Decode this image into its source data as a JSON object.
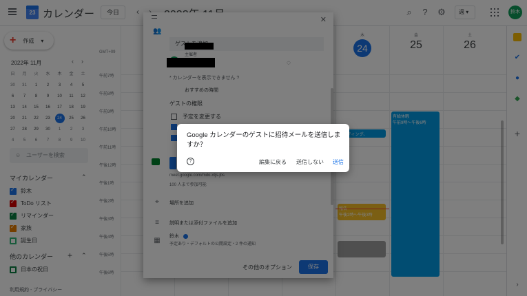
{
  "header": {
    "title": "カレンダー",
    "today_label": "今日",
    "month_title": "2022年 11月",
    "view_label": "週",
    "avatar_text": "鈴木",
    "calendar_logo_day": "23"
  },
  "sidebar": {
    "create_label": "作成",
    "mini_cal_title": "2022年 11月",
    "weekday_headers": [
      "日",
      "月",
      "火",
      "水",
      "木",
      "金",
      "土"
    ],
    "mini_cal_days": [
      [
        "30",
        "31",
        "1",
        "2",
        "3",
        "4",
        "5"
      ],
      [
        "6",
        "7",
        "8",
        "9",
        "10",
        "11",
        "12"
      ],
      [
        "13",
        "14",
        "15",
        "16",
        "17",
        "18",
        "19"
      ],
      [
        "20",
        "21",
        "22",
        "23",
        "24",
        "25",
        "26"
      ],
      [
        "27",
        "28",
        "29",
        "30",
        "1",
        "2",
        "3"
      ],
      [
        "4",
        "5",
        "6",
        "7",
        "8",
        "9",
        "10"
      ]
    ],
    "search_people_placeholder": "ユーザーを検索",
    "my_calendars_title": "マイカレンダー",
    "my_calendars": [
      {
        "label": "鈴木",
        "color": "#1a73e8",
        "checked": true
      },
      {
        "label": "ToDo リスト",
        "color": "#d50000",
        "checked": true
      },
      {
        "label": "リマインダー",
        "color": "#0b8043",
        "checked": true
      },
      {
        "label": "家族",
        "color": "#e67c00",
        "checked": true
      },
      {
        "label": "誕生日",
        "color": "#33b679",
        "checked": false
      }
    ],
    "other_calendars_title": "他のカレンダー",
    "other_calendars": [
      {
        "label": "日本の祝日",
        "color": "#0b8043",
        "checked": false
      }
    ],
    "footer": "利用規約 - プライバシー"
  },
  "grid": {
    "timezone": "GMT+09",
    "days": [
      {
        "dow": "木",
        "num": "24",
        "today": true
      },
      {
        "dow": "金",
        "num": "25",
        "today": false
      },
      {
        "dow": "土",
        "num": "26",
        "today": false
      }
    ],
    "times": [
      "午前7時",
      "午前8時",
      "午前9時",
      "午前10時",
      "午前11時",
      "午後12時",
      "午後1時",
      "午後2時",
      "午後3時",
      "午後4時",
      "午後5時",
      "午後6時"
    ],
    "events": {
      "paid_leave_title": "有給休暇",
      "paid_leave_time": "午前9時～午後6時",
      "meeting_label": "ミーティング、",
      "other_event_title": "報告",
      "other_event_time": "午後2時～午後3時"
    }
  },
  "editor": {
    "add_guests": "ゲストを追加",
    "guest_avatar_text": "鈴木",
    "organizer_label": "主催者",
    "calendar_unavailable": "* カレンダーを表示できません",
    "help_mark": "?",
    "suggested_times": "おすすめの時間",
    "permissions_title": "ゲストの権限",
    "permissions": [
      {
        "label": "予定を変更する",
        "checked": false
      },
      {
        "label": "",
        "checked": true
      },
      {
        "label": "",
        "checked": true
      }
    ],
    "meet_link": "meet.google.com/mdo-xtjs-jbs",
    "meet_capacity": "100 人まで参加可能",
    "add_location": "場所を追加",
    "add_description": "説明または添付ファイルを追加",
    "calendar_owner": "鈴木",
    "calendar_details": "予定あり・デフォルトの公開設定・2 件の通知",
    "more_options": "その他のオプション",
    "save": "保存"
  },
  "dialog": {
    "message": "Google カレンダーのゲストに招待メールを送信しますか？",
    "help": "?",
    "back_to_edit": "編集に戻る",
    "dont_send": "送信しない",
    "send": "送信",
    "send_color": "#1a73e8"
  }
}
